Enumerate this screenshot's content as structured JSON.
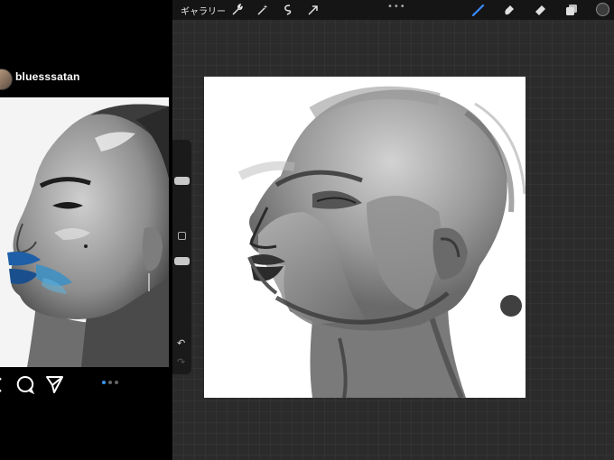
{
  "instagram": {
    "username": "bluesssatan",
    "actions": [
      "comment-icon",
      "share-icon"
    ],
    "carousel": {
      "count": 3,
      "active": 0
    }
  },
  "procreate": {
    "gallery_label": "ギャラリー",
    "toolbar_left_icons": [
      "wrench-icon",
      "magic-wand-icon",
      "selection-icon",
      "transform-arrow-icon"
    ],
    "toolbar_right_icons": [
      "brush-icon",
      "smudge-icon",
      "eraser-icon",
      "layers-icon"
    ],
    "more_label": "•••",
    "accent_color": "#3b8cff",
    "current_color": "#3c3c3c"
  }
}
